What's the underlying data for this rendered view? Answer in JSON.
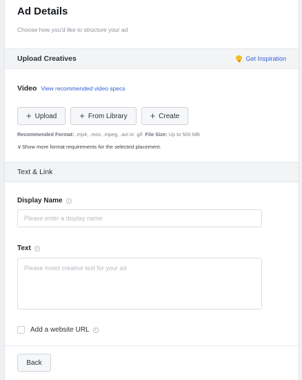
{
  "header": {
    "title": "Ad Details",
    "subtitle": "Choose how you'd like to structure your ad"
  },
  "upload_section": {
    "title": "Upload Creatives",
    "inspiration_label": "Get Inspiration",
    "video_label": "Video",
    "specs_link": "View recommended video specs",
    "buttons": {
      "upload": "Upload",
      "library": "From Library",
      "create": "Create"
    },
    "format_label": "Recommended Format:",
    "format_value": ".mp4, .mov, .mpeg, .avi or .gif",
    "size_label": "File Size:",
    "size_value": "Up to 500 MB",
    "more_link": "Show more format requirements for the selected placement."
  },
  "text_link_section": {
    "title": "Text & Link",
    "display_name_label": "Display Name",
    "display_name_placeholder": "Please enter a display name",
    "text_label": "Text",
    "text_placeholder": "Please insert creative text for your ad",
    "website_checkbox_label": "Add a website URL",
    "website_checked": false
  },
  "footer": {
    "back_label": "Back"
  },
  "colors": {
    "link": "#2f5fd6",
    "bulb": "#f7b928",
    "section_bg": "#f3f4f6"
  }
}
